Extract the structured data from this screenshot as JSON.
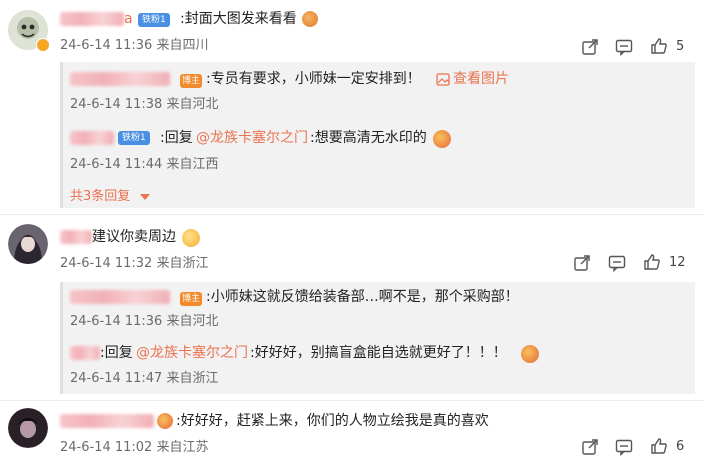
{
  "comments": [
    {
      "text": ":封面大图发来看看",
      "meta": "24-6-14 11:36 来自四川",
      "fan_badge": "铁粉1",
      "likes": "5",
      "replies": [
        {
          "text": ":专员有要求，小师妹一定安排到！",
          "badge": "博主",
          "link": "查看图片",
          "meta": "24-6-14 11:38 来自河北"
        },
        {
          "text_prefix": ":回复",
          "mention": "@龙族卡塞尔之门",
          "text": ":想要高清无水印的",
          "badge": "铁粉1",
          "meta": "24-6-14 11:44 来自江西"
        }
      ],
      "more_replies": "共3条回复"
    },
    {
      "text": "建议你卖周边",
      "meta": "24-6-14 11:32 来自浙江",
      "likes": "12",
      "replies": [
        {
          "text": ":小师妹这就反馈给装备部…啊不是，那个采购部！",
          "badge": "博主",
          "meta": "24-6-14 11:36 来自河北"
        },
        {
          "text_prefix": ":回复",
          "mention": "@龙族卡塞尔之门",
          "text": ":好好好，别搞盲盒能自选就更好了！！！",
          "meta": "24-6-14 11:47 来自浙江"
        }
      ]
    },
    {
      "text": ":好好好，赶紧上来，你们的人物立绘我是真的喜欢",
      "meta": "24-6-14 11:02 来自江苏",
      "likes": "6"
    }
  ],
  "visible_username_fragment": "a",
  "colors": {
    "link": "#eb7350",
    "mention": "#eb7350",
    "fan_badge": "#4a90e2",
    "blogger_badge": "#f08a2a"
  },
  "icons": [
    "share-icon",
    "comment-icon",
    "like-icon",
    "image-icon",
    "caret-down-icon",
    "emoji-icon"
  ]
}
